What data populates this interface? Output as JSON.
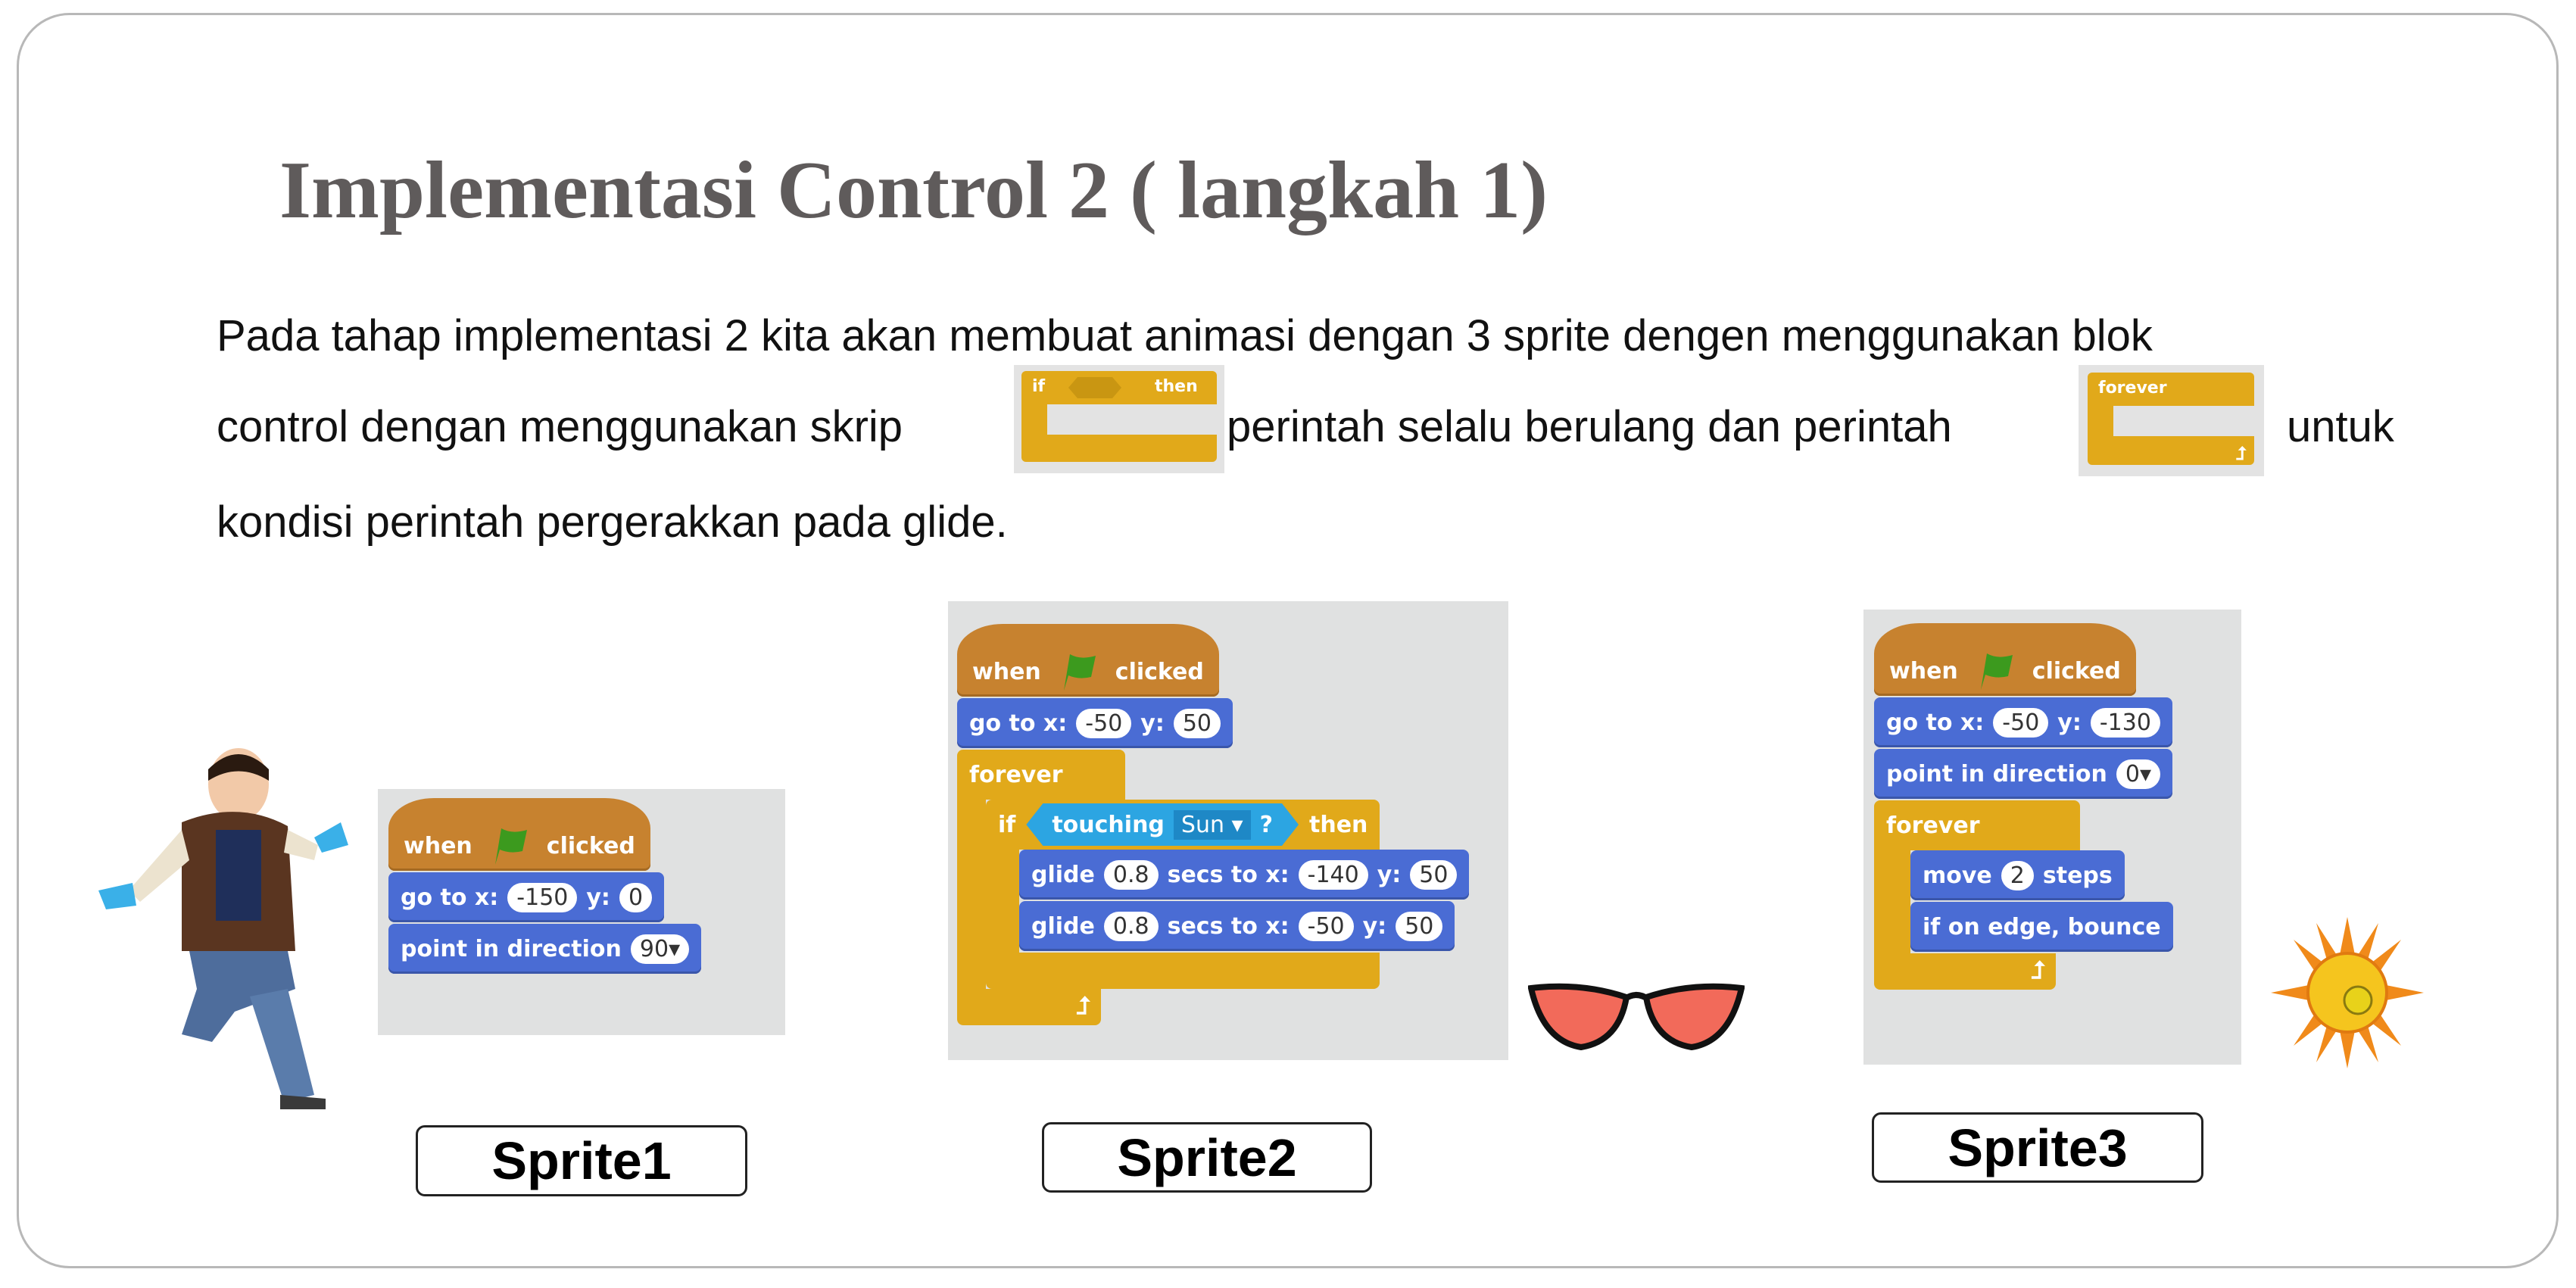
{
  "title": "Implementasi Control 2 ( langkah 1)",
  "paragraph": {
    "line1": "Pada tahap implementasi 2 kita akan membuat animasi dengan 3 sprite dengen menggunakan blok",
    "line2a": "control dengan menggunakan skrip",
    "line2b": "perintah selalu berulang dan perintah",
    "line2c": "untuk",
    "line3": "kondisi perintah pergerakkan pada glide.",
    "if_block": {
      "if": "if",
      "then": "then"
    },
    "forever_block": {
      "label": "forever"
    }
  },
  "colors": {
    "motion": "#4a6cd4",
    "events": "#c7822f",
    "control": "#e1a91a",
    "sensing": "#2ca5e2",
    "flag": "#3c9a1e"
  },
  "common": {
    "when": "when",
    "clicked": "clicked",
    "go_to_x": "go to x:",
    "y": "y:",
    "point_in_direction": "point in direction",
    "forever": "forever",
    "if": "if",
    "then": "then",
    "touching": "touching",
    "question": "?",
    "glide": "glide",
    "secs_to_x": "secs to x:",
    "move": "move",
    "steps": "steps",
    "bounce": "if on edge, bounce"
  },
  "sprite1": {
    "label": "Sprite1",
    "goto_x": "-150",
    "goto_y": "0",
    "direction": "90"
  },
  "sprite2": {
    "label": "Sprite2",
    "goto_x": "-50",
    "goto_y": "50",
    "touching_target": "Sun",
    "glide1": {
      "secs": "0.8",
      "x": "-140",
      "y": "50"
    },
    "glide2": {
      "secs": "0.8",
      "x": "-50",
      "y": "50"
    }
  },
  "sprite3": {
    "label": "Sprite3",
    "goto_x": "-50",
    "goto_y": "-130",
    "direction": "0",
    "move_steps": "2"
  }
}
